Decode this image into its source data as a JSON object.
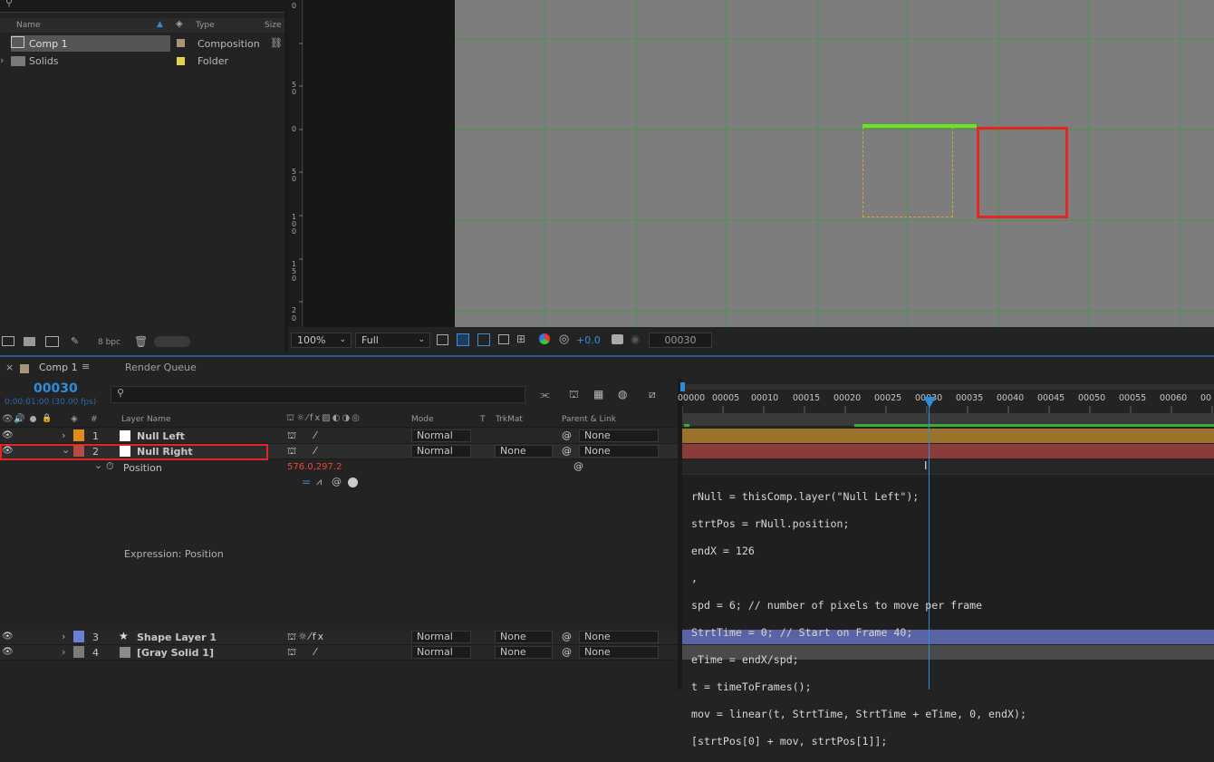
{
  "project": {
    "columns": {
      "name": "Name",
      "type": "Type",
      "size": "Size"
    },
    "items": [
      {
        "name": "Comp 1",
        "type": "Composition",
        "label_color": "#a8957a"
      },
      {
        "name": "Solids",
        "type": "Folder",
        "label_color": "#e3d34c"
      }
    ],
    "bpc": "8 bpc"
  },
  "viewer": {
    "ruler_labels": [
      "0",
      "5\n0",
      "0",
      "5\n0",
      "1\n0\n0",
      "1\n5\n0",
      "2\n0"
    ],
    "zoom": "100%",
    "resolution": "Full",
    "exposure": "+0.0",
    "current_frame": "00030"
  },
  "timeline": {
    "tabs": [
      {
        "label": "Comp 1"
      },
      {
        "label": "Render Queue"
      }
    ],
    "timecode": "00030",
    "timecode_sub": "0:00:01:00 (30.00 fps)",
    "col_headers": {
      "hash": "#",
      "layer_name": "Layer Name",
      "mode": "Mode",
      "t": "T",
      "trkmat": "TrkMat",
      "parent": "Parent & Link"
    },
    "ruler_ticks": [
      "00000",
      "00005",
      "00010",
      "00015",
      "00020",
      "00025",
      "00030",
      "00035",
      "00040",
      "00045",
      "00050",
      "00055",
      "00060",
      "00"
    ],
    "playhead_frame": 30,
    "layers": [
      {
        "num": "1",
        "name": "Null Left",
        "label_color": "#e38b1a",
        "mode": "Normal",
        "trkmat": "",
        "parent": "None",
        "bar_color": "#9a7229"
      },
      {
        "num": "2",
        "name": "Null Right",
        "label_color": "#b84a44",
        "mode": "Normal",
        "trkmat": "None",
        "parent": "None",
        "bar_color": "#8a3b3a"
      },
      {
        "num": "3",
        "name": "Shape Layer 1",
        "label_color": "#6b7fd8",
        "mode": "Normal",
        "trkmat": "None",
        "parent": "None",
        "bar_color": "#5a64a4"
      },
      {
        "num": "4",
        "name": "[Gray Solid 1]",
        "label_color": "#7b7b7b",
        "mode": "Normal",
        "trkmat": "None",
        "parent": "None",
        "bar_color": "#4a4a4a"
      }
    ],
    "property": {
      "name": "Position",
      "value": "576.0,297.2"
    },
    "expression_label": "Expression: Position",
    "expression_lines": [
      "rNull = thisComp.layer(\"Null Left\");",
      "strtPos = rNull.position;",
      "endX = 126",
      ",",
      "spd = 6; // number of pixels to move per frame",
      "StrtTime = 0; // Start on Frame 40;",
      "eTime = endX/spd;",
      "t = timeToFrames();",
      "mov = linear(t, StrtTime, StrtTime + eTime, 0, endX);",
      "[strtPos[0] + mov, strtPos[1]];"
    ]
  }
}
